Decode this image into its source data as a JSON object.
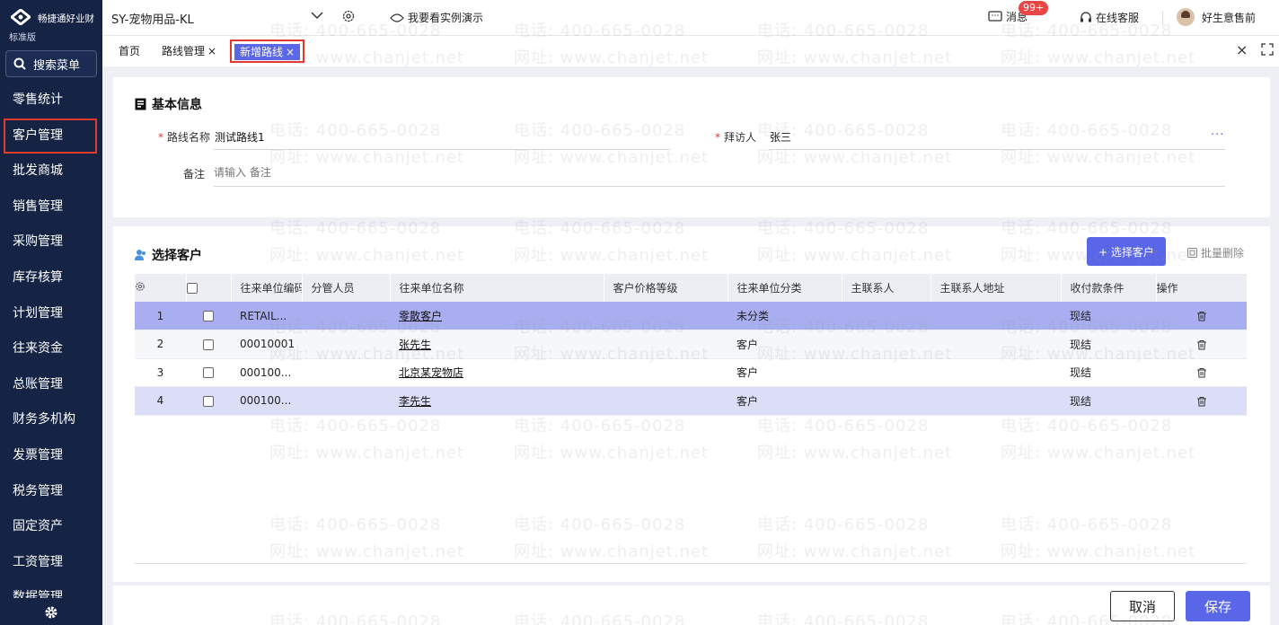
{
  "sidebar": {
    "brand": "畅捷通好业财",
    "edition": "标准版",
    "search_label": "搜索菜单",
    "items": [
      {
        "label": "零售统计"
      },
      {
        "label": "客户管理"
      },
      {
        "label": "批发商城"
      },
      {
        "label": "销售管理"
      },
      {
        "label": "采购管理"
      },
      {
        "label": "库存核算"
      },
      {
        "label": "计划管理"
      },
      {
        "label": "往来资金"
      },
      {
        "label": "总账管理"
      },
      {
        "label": "财务多机构"
      },
      {
        "label": "发票管理"
      },
      {
        "label": "税务管理"
      },
      {
        "label": "固定资产"
      },
      {
        "label": "工资管理"
      },
      {
        "label": "数据管理"
      }
    ],
    "active_index": 1
  },
  "topbar": {
    "company": "SY-宠物用品-KL",
    "demo_link": "我要看实例演示",
    "messages_label": "消息",
    "messages_badge": "99+",
    "service_label": "在线客服",
    "user_name": "好生意售前"
  },
  "tabs": {
    "home": "首页",
    "route_mgmt": "路线管理",
    "new_route": "新增路线",
    "close_symbol": "×"
  },
  "basic_info": {
    "title": "基本信息",
    "route_name_label": "路线名称",
    "route_name_value": "测试路线1",
    "visitor_label": "拜访人",
    "visitor_value": "张三",
    "remark_label": "备注",
    "remark_placeholder": "请输入 备注",
    "required_mark": "*",
    "more": "···"
  },
  "customers": {
    "title": "选择客户",
    "select_button": "+ 选择客户",
    "batch_delete": "批量删除",
    "columns": [
      "",
      "",
      "往来单位编码",
      "分管人员",
      "往来单位名称",
      "客户价格等级",
      "往来单位分类",
      "主联系人",
      "主联系人地址",
      "收付款条件",
      "操作"
    ],
    "rows": [
      {
        "no": "1",
        "code": "RETAIL...",
        "manager": "",
        "name": "零散客户",
        "price_level": "",
        "category": "未分类",
        "contact": "",
        "address": "",
        "terms": "现结"
      },
      {
        "no": "2",
        "code": "00010001",
        "manager": "",
        "name": "张先生",
        "price_level": "",
        "category": "客户",
        "contact": "",
        "address": "",
        "terms": "现结"
      },
      {
        "no": "3",
        "code": "000100...",
        "manager": "",
        "name": "北京某宠物店",
        "price_level": "",
        "category": "客户",
        "contact": "",
        "address": "",
        "terms": "现结"
      },
      {
        "no": "4",
        "code": "000100...",
        "manager": "",
        "name": "李先生",
        "price_level": "",
        "category": "客户",
        "contact": "",
        "address": "",
        "terms": "现结"
      }
    ]
  },
  "footer": {
    "cancel": "取消",
    "save": "保存"
  },
  "watermark": {
    "phone": "电话: 400-665-0028",
    "site": "网址: www.chanjet.net"
  },
  "colors": {
    "sidebar_bg": "#152344",
    "accent": "#5a66e8",
    "highlight_red": "#e0392d",
    "selected_row": "#a9aef0",
    "hover_row": "#dcdef8"
  }
}
